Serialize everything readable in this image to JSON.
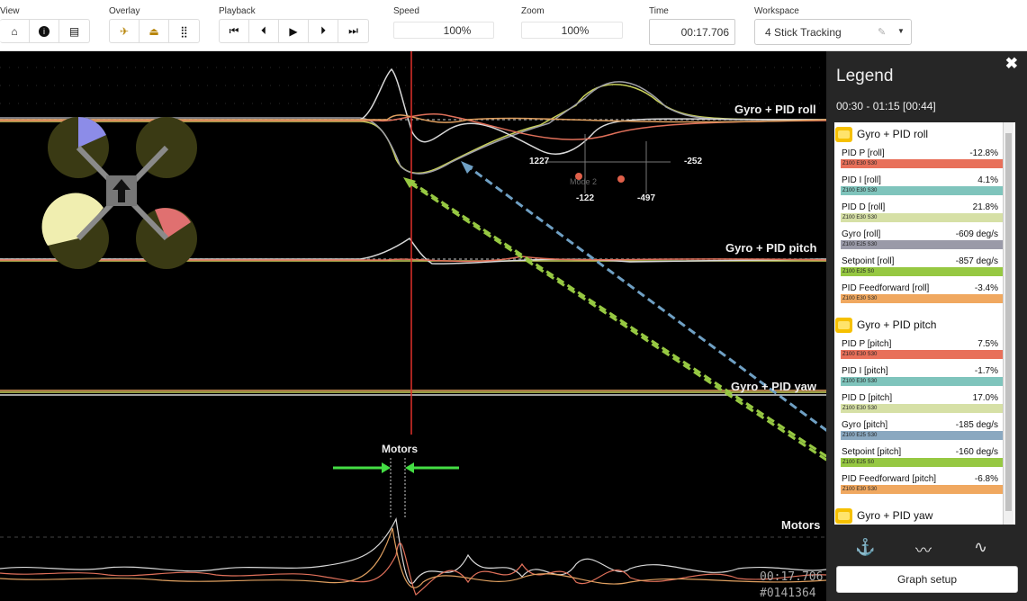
{
  "toolbar": {
    "groups": {
      "view": "View",
      "overlay": "Overlay",
      "playback": "Playback",
      "speed": "Speed",
      "zoom": "Zoom",
      "time": "Time",
      "workspace": "Workspace"
    },
    "speed_value": "100%",
    "zoom_value": "100%",
    "time_value": "00:17.706",
    "workspace_value": "4 Stick Tracking"
  },
  "graph": {
    "labels": {
      "roll": "Gyro + PID roll",
      "pitch": "Gyro + PID pitch",
      "yaw": "Gyro + PID yaw",
      "motors_top": "Motors",
      "motors_bottom": "Motors"
    },
    "stick_values": {
      "left_x": "1227",
      "right_x": "-252",
      "left_y": "-122",
      "right_y": "-497",
      "mode": "Mode 2"
    },
    "timestamp": "00:17.706",
    "frame": "#0141364"
  },
  "legend": {
    "title": "Legend",
    "close": "✖",
    "range": "00:30 - 01:15 [00:44]",
    "sections": [
      {
        "title": "Gyro + PID roll",
        "items": [
          {
            "name": "PID P [roll]",
            "value": "-12.8%",
            "bar": "Z100 E30 S30",
            "color": "#e8705a"
          },
          {
            "name": "PID I [roll]",
            "value": "4.1%",
            "bar": "Z100 E30 S30",
            "color": "#7fc4bc"
          },
          {
            "name": "PID D [roll]",
            "value": "21.8%",
            "bar": "Z100 E30 S30",
            "color": "#d6e0a6"
          },
          {
            "name": "Gyro [roll]",
            "value": "-609 deg/s",
            "bar": "Z100 E25 S30",
            "color": "#9a9aa8"
          },
          {
            "name": "Setpoint [roll]",
            "value": "-857 deg/s",
            "bar": "Z100 E25 S0",
            "color": "#96c842"
          },
          {
            "name": "PID Feedforward [roll]",
            "value": "-3.4%",
            "bar": "Z100 E30 S30",
            "color": "#f0a860"
          }
        ]
      },
      {
        "title": "Gyro + PID pitch",
        "items": [
          {
            "name": "PID P [pitch]",
            "value": "7.5%",
            "bar": "Z100 E30 S30",
            "color": "#e8705a"
          },
          {
            "name": "PID I [pitch]",
            "value": "-1.7%",
            "bar": "Z100 E30 S30",
            "color": "#7fc4bc"
          },
          {
            "name": "PID D [pitch]",
            "value": "17.0%",
            "bar": "Z100 E30 S30",
            "color": "#d6e0a6"
          },
          {
            "name": "Gyro [pitch]",
            "value": "-185 deg/s",
            "bar": "Z100 E25 S30",
            "color": "#8aa8c0"
          },
          {
            "name": "Setpoint [pitch]",
            "value": "-160 deg/s",
            "bar": "Z100 E25 S0",
            "color": "#96c842"
          },
          {
            "name": "PID Feedforward [pitch]",
            "value": "-6.8%",
            "bar": "Z100 E30 S30",
            "color": "#f0a860"
          }
        ]
      },
      {
        "title": "Gyro + PID yaw",
        "items": []
      }
    ],
    "graph_setup": "Graph setup"
  }
}
